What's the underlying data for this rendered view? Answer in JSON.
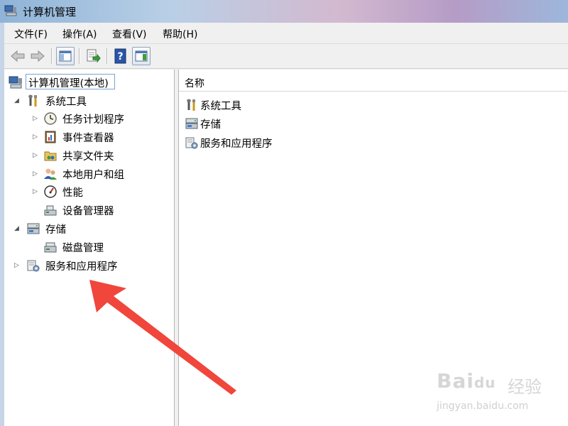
{
  "window": {
    "title": "计算机管理"
  },
  "menu": [
    "文件(F)",
    "操作(A)",
    "查看(V)",
    "帮助(H)"
  ],
  "toolbar": {
    "icons": [
      "back-arrow-icon",
      "forward-arrow-icon",
      "show-hide-console-tree-icon",
      "export-list-icon",
      "help-icon",
      "show-hide-action-pane-icon"
    ]
  },
  "tree": {
    "root": "计算机管理(本地)",
    "system_tools": {
      "label": "系统工具",
      "children": [
        "任务计划程序",
        "事件查看器",
        "共享文件夹",
        "本地用户和组",
        "性能",
        "设备管理器"
      ]
    },
    "storage": {
      "label": "存储",
      "children": [
        "磁盘管理"
      ]
    },
    "services": {
      "label": "服务和应用程序"
    }
  },
  "list": {
    "column_header": "名称",
    "items": [
      "系统工具",
      "存储",
      "服务和应用程序"
    ]
  },
  "annotation": {
    "arrow_color": "#f0463c"
  },
  "watermark": {
    "brand": "Bai",
    "brand2": "du",
    "cn": "经验",
    "url": "jingyan.baidu.com"
  }
}
